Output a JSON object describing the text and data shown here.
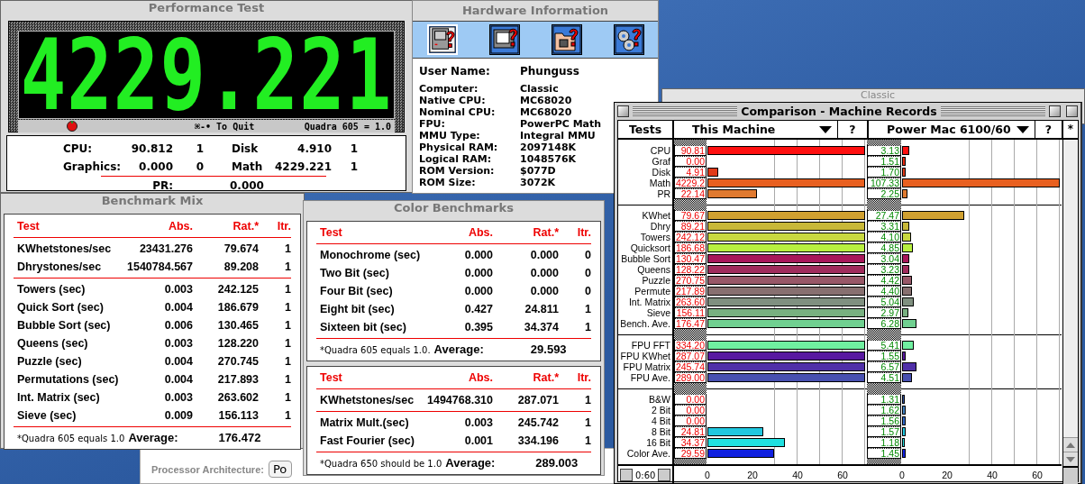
{
  "classic_window": {
    "title": "Classic"
  },
  "processor_window": {
    "label": "Processor Architecture:",
    "button": "Po"
  },
  "performance_test": {
    "title": "Performance Test",
    "display": "4229.221",
    "quit_hint": "⌘-• To Quit",
    "baseline": "Quadra 605 = 1.0",
    "stats": [
      {
        "label": "CPU:",
        "value": "90.812",
        "iterations": "1"
      },
      {
        "label": "Disk",
        "value": "4.910",
        "iterations": "1"
      },
      {
        "label": "Graphics:",
        "value": "0.000",
        "iterations": "0"
      },
      {
        "label": "Math",
        "value": "4229.221",
        "iterations": "1"
      }
    ],
    "pr": {
      "label": "PR:",
      "value": "0.000"
    }
  },
  "hardware_info": {
    "title": "Hardware Information",
    "tabs": [
      {
        "kind": "computer",
        "selected": true
      },
      {
        "kind": "monitor",
        "selected": false
      },
      {
        "kind": "folder",
        "selected": false
      },
      {
        "kind": "gears",
        "selected": false
      }
    ],
    "user": {
      "label": "User Name:",
      "value": "Phunguss"
    },
    "fields": [
      {
        "label": "Computer:",
        "value": "Classic"
      },
      {
        "label": "Native CPU:",
        "value": "MC68020"
      },
      {
        "label": "Nominal CPU:",
        "value": "MC68020"
      },
      {
        "label": "FPU:",
        "value": "PowerPC Math"
      },
      {
        "label": "MMU Type:",
        "value": "Integral MMU"
      },
      {
        "label": "Physical RAM:",
        "value": "2097148K"
      },
      {
        "label": "Logical RAM:",
        "value": "1048576K"
      },
      {
        "label": "ROM Version:",
        "value": "$077D"
      },
      {
        "label": "ROM Size:",
        "value": "3072K"
      }
    ]
  },
  "benchmark_mix": {
    "title": "Benchmark Mix",
    "panels": [
      {
        "columns": [
          "Test",
          "Abs.",
          "Rat.*",
          "Itr."
        ],
        "groups": [
          [
            {
              "cells": [
                "KWhetstones/sec",
                "23431.276",
                "79.674",
                "1"
              ]
            },
            {
              "cells": [
                "Dhrystones/sec",
                "1540784.567",
                "89.208",
                "1"
              ]
            }
          ],
          [
            {
              "cells": [
                "Towers (sec)",
                "0.003",
                "242.125",
                "1"
              ]
            },
            {
              "cells": [
                "Quick Sort (sec)",
                "0.004",
                "186.679",
                "1"
              ]
            },
            {
              "cells": [
                "Bubble Sort (sec)",
                "0.006",
                "130.465",
                "1"
              ]
            },
            {
              "cells": [
                "Queens (sec)",
                "0.003",
                "128.220",
                "1"
              ]
            },
            {
              "cells": [
                "Puzzle (sec)",
                "0.004",
                "270.745",
                "1"
              ]
            },
            {
              "cells": [
                "Permutations (sec)",
                "0.004",
                "217.893",
                "1"
              ]
            },
            {
              "cells": [
                "Int. Matrix (sec)",
                "0.003",
                "263.602",
                "1"
              ]
            },
            {
              "cells": [
                "Sieve (sec)",
                "0.009",
                "156.113",
                "1"
              ]
            }
          ]
        ],
        "note": "*Quadra 605 equals 1.0",
        "average_label": "Average:",
        "average": "176.472"
      }
    ]
  },
  "color_benchmarks": {
    "title": "Color Benchmarks",
    "panels": [
      {
        "columns": [
          "Test",
          "Abs.",
          "Rat.*",
          "Itr."
        ],
        "groups": [
          [
            {
              "cells": [
                "Monochrome (sec)",
                "0.000",
                "0.000",
                "0"
              ]
            },
            {
              "cells": [
                "Two Bit (sec)",
                "0.000",
                "0.000",
                "0"
              ]
            },
            {
              "cells": [
                "Four Bit (sec)",
                "0.000",
                "0.000",
                "0"
              ]
            },
            {
              "cells": [
                "Eight bit (sec)",
                "0.427",
                "24.811",
                "1"
              ]
            },
            {
              "cells": [
                "Sixteen bit (sec)",
                "0.395",
                "34.374",
                "1"
              ]
            }
          ]
        ],
        "note": "*Quadra 605 equals 1.0.",
        "average_label": "Average:",
        "average": "29.593"
      },
      {
        "columns": [
          "Test",
          "Abs.",
          "Rat.*",
          "Itr."
        ],
        "groups": [
          [
            {
              "cells": [
                "KWhetstones/sec",
                "1494768.310",
                "287.071",
                "1"
              ]
            }
          ],
          [
            {
              "cells": [
                "Matrix Mult.(sec)",
                "0.003",
                "245.742",
                "1"
              ]
            },
            {
              "cells": [
                "Fast Fourier (sec)",
                "0.001",
                "334.196",
                "1"
              ]
            }
          ]
        ],
        "note": "*Quadra 650 should be 1.0",
        "average_label": "Average:",
        "average": "289.003"
      }
    ]
  },
  "comparison": {
    "title": "Comparison - Machine Records",
    "tests_heading": "Tests",
    "corner": "*",
    "time": "0:60",
    "machines": [
      {
        "name": "This Machine",
        "help": "?",
        "ticks": [
          "0",
          "20",
          "40",
          "60"
        ]
      },
      {
        "name": "Power Mac 6100/60",
        "help": "?",
        "ticks": [
          "0",
          "20",
          "40",
          "60"
        ]
      }
    ],
    "groups": [
      [
        {
          "label": "CPU",
          "color": "#ff1010",
          "results": [
            {
              "reading": "90.81",
              "level": 1
            },
            {
              "reading": "3.13",
              "level": 0.045
            }
          ]
        },
        {
          "label": "Graf",
          "color": "#e82a10",
          "results": [
            {
              "reading": "0.00"
            },
            {
              "reading": "1.51",
              "level": 0.022
            }
          ]
        },
        {
          "label": "Disk",
          "color": "#e03a18",
          "results": [
            {
              "reading": "4.91",
              "level": 0.07
            },
            {
              "reading": "1.70",
              "level": 0.024
            }
          ]
        },
        {
          "label": "Math",
          "color": "#e86020",
          "results": [
            {
              "reading": "4229.2",
              "level": 1
            },
            {
              "reading": "107.33",
              "level": 1
            }
          ]
        },
        {
          "label": "PR",
          "color": "#e07a30",
          "results": [
            {
              "reading": "22.14",
              "level": 0.316
            },
            {
              "reading": "2.25",
              "level": 0.032
            }
          ]
        }
      ],
      [
        {
          "label": "KWhet",
          "color": "#d0a030",
          "results": [
            {
              "reading": "79.67",
              "level": 1
            },
            {
              "reading": "27.47",
              "level": 0.392
            }
          ]
        },
        {
          "label": "Dhry",
          "color": "#c8b838",
          "results": [
            {
              "reading": "89.21",
              "level": 1
            },
            {
              "reading": "3.31",
              "level": 0.047
            }
          ]
        },
        {
          "label": "Towers",
          "color": "#c8d840",
          "results": [
            {
              "reading": "242.12",
              "level": 1
            },
            {
              "reading": "4.10",
              "level": 0.059
            }
          ]
        },
        {
          "label": "Quicksort",
          "color": "#b8f040",
          "results": [
            {
              "reading": "186.68",
              "level": 1
            },
            {
              "reading": "4.85",
              "level": 0.069
            }
          ]
        },
        {
          "label": "Bubble Sort",
          "color": "#a8185a",
          "results": [
            {
              "reading": "130.47",
              "level": 1
            },
            {
              "reading": "3.04",
              "level": 0.043
            }
          ]
        },
        {
          "label": "Queens",
          "color": "#a02c5c",
          "results": [
            {
              "reading": "128.22",
              "level": 1
            },
            {
              "reading": "3.23",
              "level": 0.046
            }
          ]
        },
        {
          "label": "Puzzle",
          "color": "#985868",
          "results": [
            {
              "reading": "270.75",
              "level": 1
            },
            {
              "reading": "4.42",
              "level": 0.063
            }
          ]
        },
        {
          "label": "Permute",
          "color": "#887070",
          "results": [
            {
              "reading": "217.89",
              "level": 1
            },
            {
              "reading": "4.40",
              "level": 0.063
            }
          ]
        },
        {
          "label": "Int. Matrix",
          "color": "#809080",
          "results": [
            {
              "reading": "263.60",
              "level": 1
            },
            {
              "reading": "5.04",
              "level": 0.072
            }
          ]
        },
        {
          "label": "Sieve",
          "color": "#78b080",
          "results": [
            {
              "reading": "156.11",
              "level": 1
            },
            {
              "reading": "2.97",
              "level": 0.042
            }
          ]
        },
        {
          "label": "Bench. Ave.",
          "color": "#70d090",
          "results": [
            {
              "reading": "176.47",
              "level": 1
            },
            {
              "reading": "6.28",
              "level": 0.09
            }
          ]
        }
      ],
      [
        {
          "label": "FPU FFT",
          "color": "#70f0a0",
          "results": [
            {
              "reading": "334.20",
              "level": 1
            },
            {
              "reading": "5.41",
              "level": 0.077
            }
          ]
        },
        {
          "label": "FPU KWhet",
          "color": "#5818a0",
          "results": [
            {
              "reading": "287.07",
              "level": 1
            },
            {
              "reading": "1.55",
              "level": 0.022
            }
          ]
        },
        {
          "label": "FPU Matrix",
          "color": "#5030a8",
          "results": [
            {
              "reading": "245.74",
              "level": 1
            },
            {
              "reading": "6.57",
              "level": 0.094
            }
          ]
        },
        {
          "label": "FPU Ave.",
          "color": "#4850b0",
          "results": [
            {
              "reading": "289.00",
              "level": 1
            },
            {
              "reading": "4.51",
              "level": 0.064
            }
          ]
        }
      ],
      [
        {
          "label": "B&W",
          "color": "#3050a0",
          "results": [
            {
              "reading": "0.00"
            },
            {
              "reading": "1.31",
              "level": 0.019
            }
          ]
        },
        {
          "label": "2 Bit",
          "color": "#4080c0",
          "results": [
            {
              "reading": "0.00"
            },
            {
              "reading": "1.62",
              "level": 0.023
            }
          ]
        },
        {
          "label": "4 Bit",
          "color": "#3068c8",
          "results": [
            {
              "reading": "0.00"
            },
            {
              "reading": "1.56",
              "level": 0.022
            }
          ]
        },
        {
          "label": "8 Bit",
          "color": "#20c8e0",
          "results": [
            {
              "reading": "24.81",
              "level": 0.354
            },
            {
              "reading": "1.57",
              "level": 0.022
            }
          ]
        },
        {
          "label": "16 Bit",
          "color": "#20e0e0",
          "results": [
            {
              "reading": "34.37",
              "level": 0.491
            },
            {
              "reading": "1.18",
              "level": 0.017
            }
          ]
        },
        {
          "label": "Color Ave.",
          "color": "#1020e0",
          "results": [
            {
              "reading": "29.59",
              "level": 0.423
            },
            {
              "reading": "1.45",
              "level": 0.021
            }
          ]
        }
      ]
    ]
  }
}
